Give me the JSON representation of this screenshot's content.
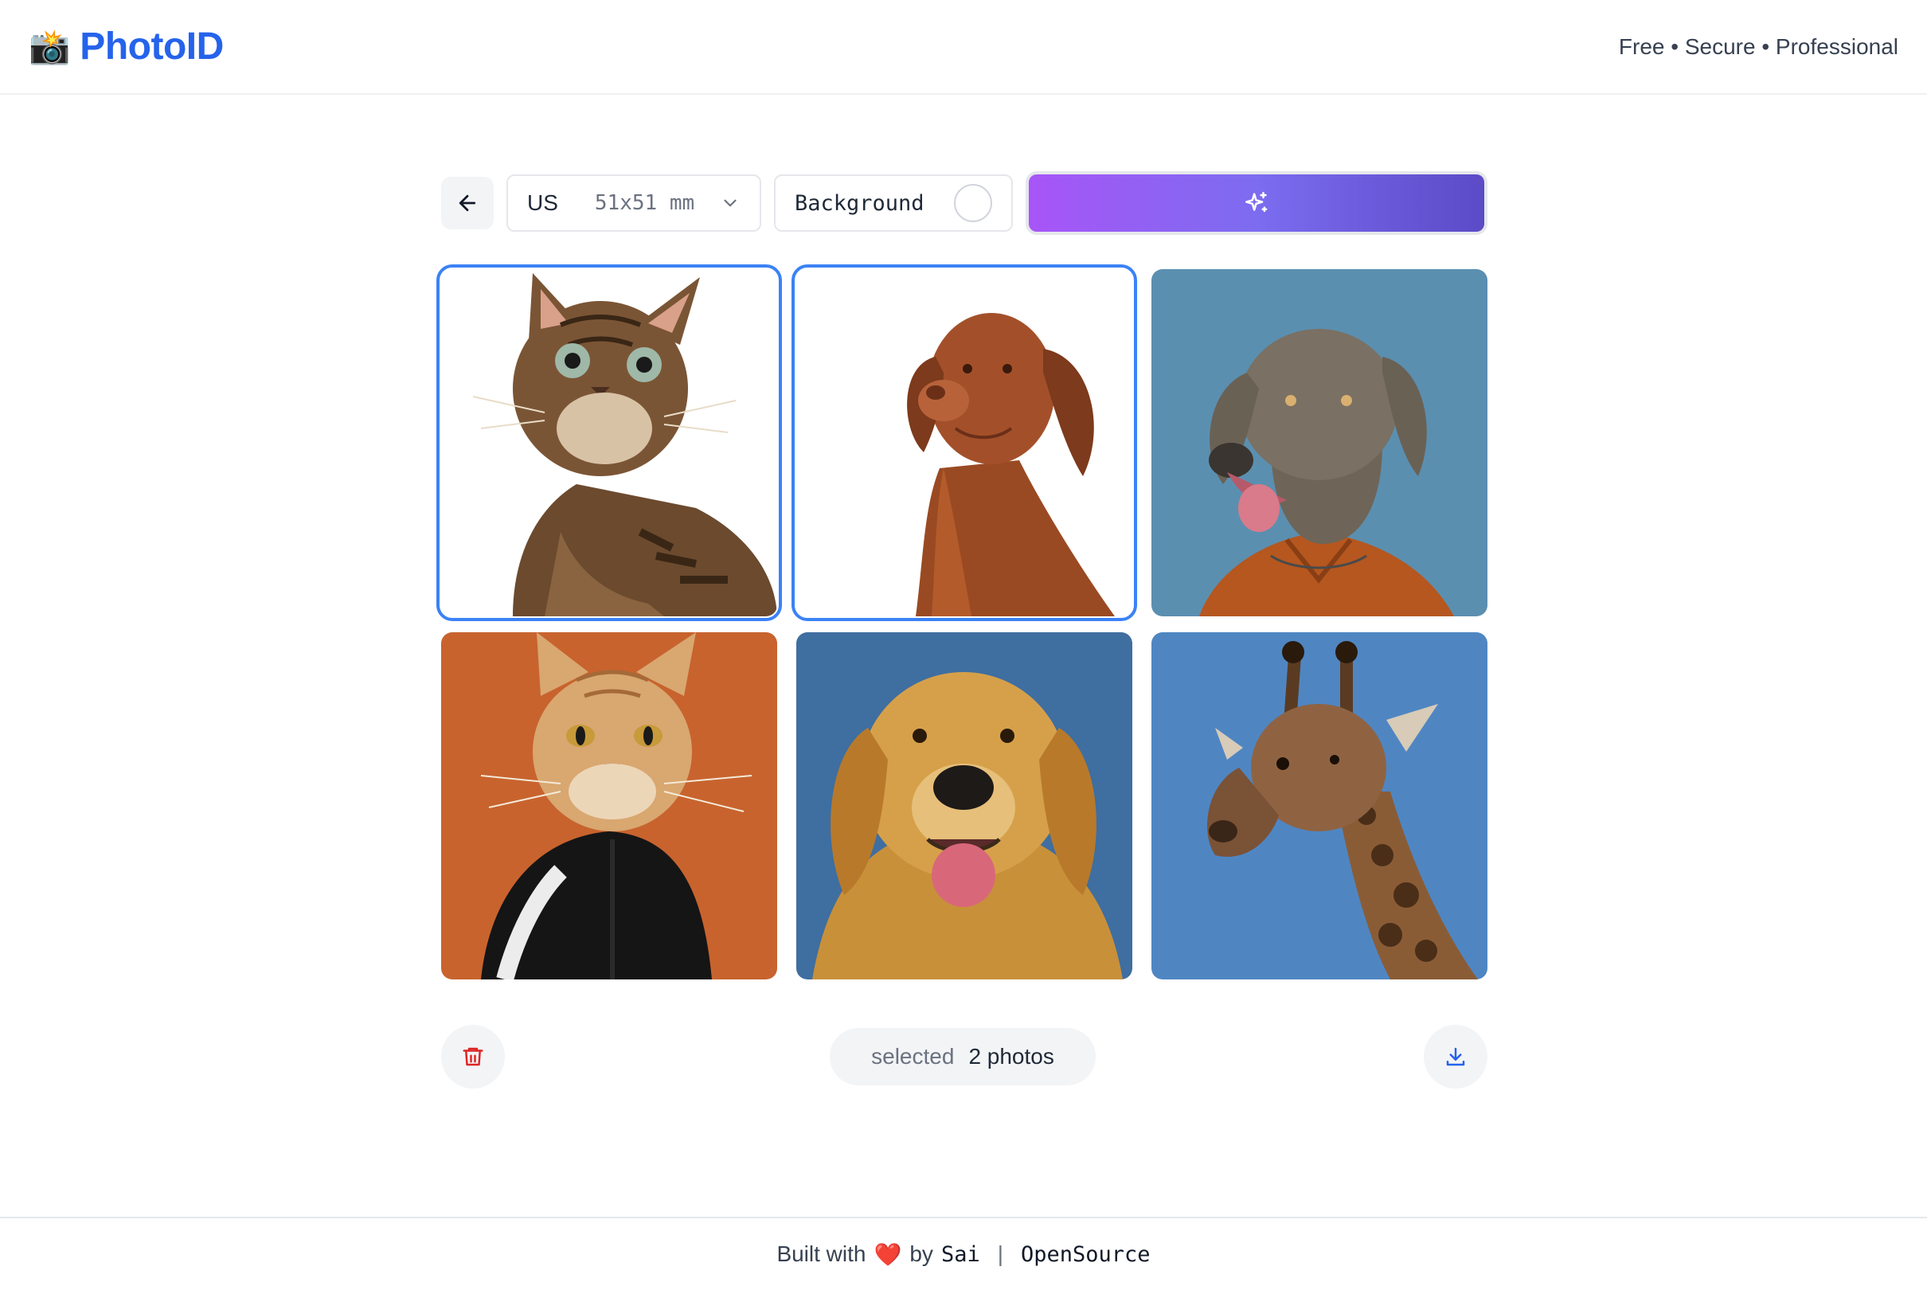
{
  "header": {
    "logo_emoji": "📸",
    "title": "PhotoID",
    "tagline": "Free • Secure • Professional",
    "brand_color": "#2563eb"
  },
  "toolbar": {
    "back_icon": "arrow-left-icon",
    "country": "US",
    "size": "51x51 mm",
    "background_label": "Background",
    "background_color": "#ffffff",
    "magic_icon": "sparkles-icon"
  },
  "photos": [
    {
      "subject": "tabby cat",
      "selected": true,
      "background": "#ffffff"
    },
    {
      "subject": "vizsla dog",
      "selected": true,
      "background": "#ffffff"
    },
    {
      "subject": "weimaraner dog",
      "selected": false,
      "background": "#5b8fb0"
    },
    {
      "subject": "orange cat in jacket",
      "selected": false,
      "background": "#c8632e"
    },
    {
      "subject": "golden retriever",
      "selected": false,
      "background": "#3f6ea0"
    },
    {
      "subject": "giraffe",
      "selected": false,
      "background": "#4f86c2"
    }
  ],
  "actions": {
    "delete_icon": "trash-icon",
    "selected_label": "selected",
    "selected_count": "2 photos",
    "download_icon": "download-icon"
  },
  "footer": {
    "built_with": "Built with",
    "heart": "❤️",
    "by": "by",
    "author": "Sai",
    "separator": "|",
    "link": "OpenSource"
  }
}
